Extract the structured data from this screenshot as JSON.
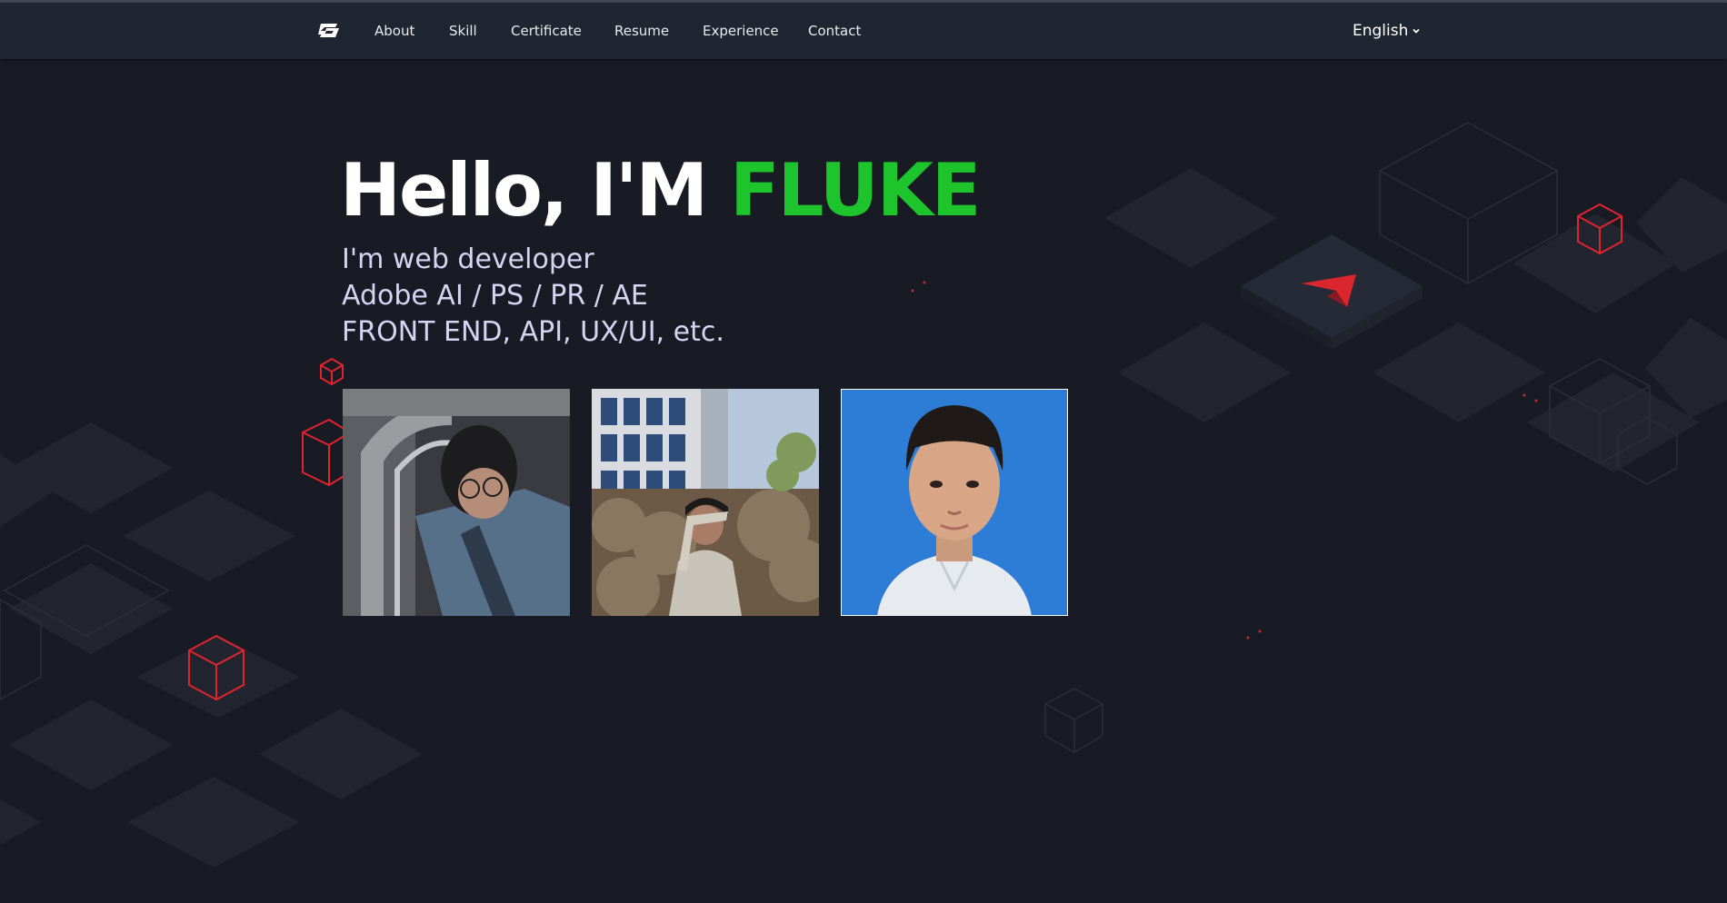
{
  "nav": {
    "logo_icon": "fg-logo-icon",
    "items": [
      {
        "label": "About"
      },
      {
        "label": "Skill"
      },
      {
        "label": "Certificate"
      },
      {
        "label": "Resume"
      },
      {
        "label": "Experience"
      },
      {
        "label": "Contact"
      }
    ],
    "language": {
      "selected": "English",
      "icon": "chevron-down-icon"
    }
  },
  "hero": {
    "greeting": "Hello, I'M",
    "name": "FLUKE",
    "lines": [
      "I'm web developer",
      "Adobe AI / PS / PR / AE",
      "FRONT END, API, UX/UI, etc."
    ]
  },
  "photos": [
    {
      "description_icon": "portrait-photo-glasses"
    },
    {
      "description_icon": "portrait-photo-outdoor"
    },
    {
      "description_icon": "portrait-photo-id"
    }
  ],
  "colors": {
    "background": "#191b24",
    "navbar": "#1f2631",
    "accent_green": "#1ec42c",
    "cube_red": "#e0242e",
    "subtitle": "#d6d3f3"
  }
}
